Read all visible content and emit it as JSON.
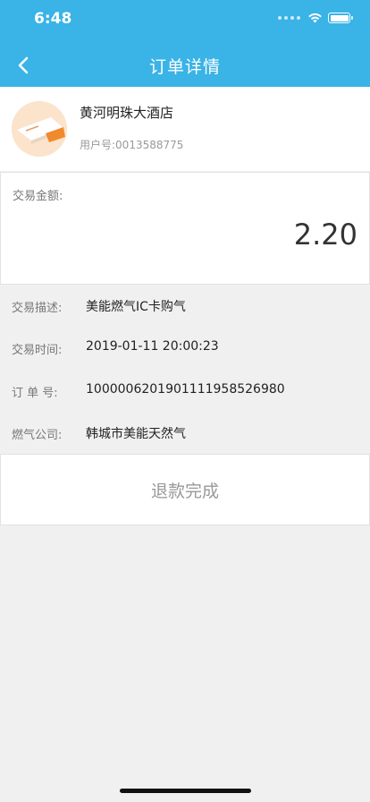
{
  "status_bar": {
    "time": "6:48"
  },
  "nav": {
    "title": "订单详情",
    "back_icon": "chevron-left-icon"
  },
  "merchant": {
    "name": "黄河明珠大酒店",
    "user_id": "用户号:0013588775",
    "avatar_icon": "card-icon"
  },
  "amount": {
    "label": "交易金额:",
    "value": "2.20"
  },
  "details": [
    {
      "label": "交易描述:",
      "value": "美能燃气IC卡购气"
    },
    {
      "label": "交易时间:",
      "value": "2019-01-11 20:00:23"
    },
    {
      "label": "订 单 号:",
      "value": "1000006201901111958526980"
    },
    {
      "label": "燃气公司:",
      "value": "韩城市美能天然气"
    }
  ],
  "status": {
    "refund_label": "退款完成"
  },
  "colors": {
    "header": "#3ab3e6",
    "background": "#f0f0f0"
  }
}
